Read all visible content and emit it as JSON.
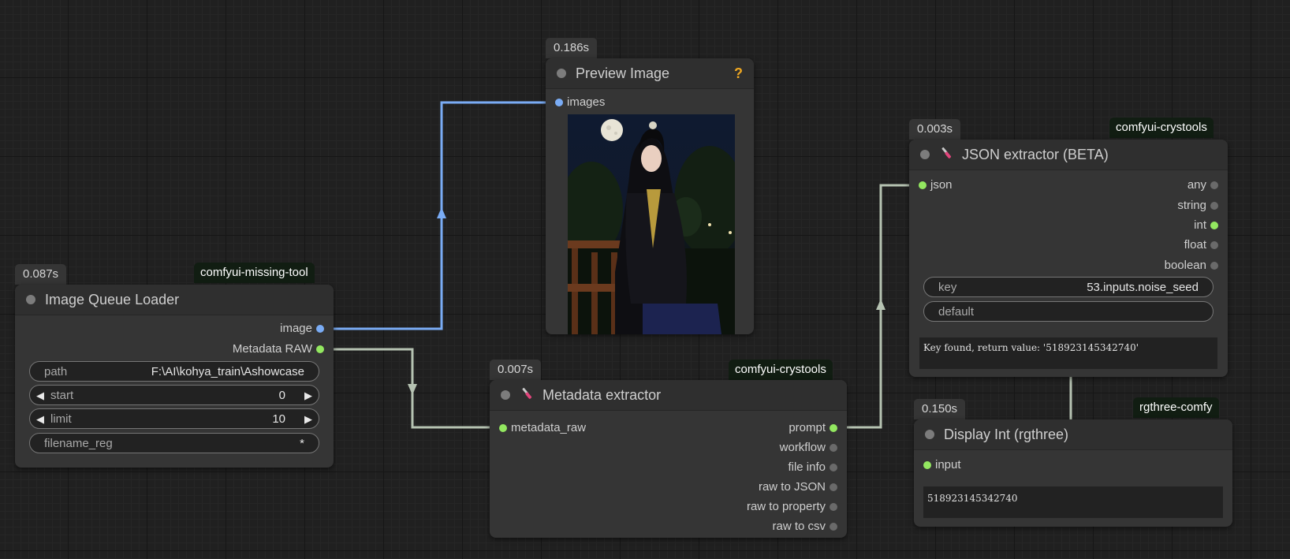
{
  "colors": {
    "canvas": "#202020",
    "node_body": "#353535",
    "image_link": "#7aacf5",
    "string_link": "#b6c3b2",
    "slot_green": "#93e860",
    "slot_blue": "#7aacf5",
    "help_icon": "#f0a821"
  },
  "nodes": {
    "loader": {
      "timing": "0.087s",
      "pack": "comfyui-missing-tool",
      "title": "Image Queue Loader",
      "outputs": [
        "image",
        "Metadata RAW"
      ],
      "widgets": {
        "path": {
          "label": "path",
          "value": "F:\\AI\\kohya_train\\Ashowcase"
        },
        "start": {
          "label": "start",
          "value": "0"
        },
        "limit": {
          "label": "limit",
          "value": "10"
        },
        "filename_reg": {
          "label": "filename_reg",
          "value": "*"
        }
      },
      "icons": {
        "decrement": "arrow-left-icon",
        "increment": "arrow-right-icon"
      }
    },
    "preview": {
      "timing": "0.186s",
      "title": "Preview Image",
      "help": "?",
      "inputs": [
        "images"
      ],
      "image": "preview-image"
    },
    "metadata": {
      "timing": "0.007s",
      "pack": "comfyui-crystools",
      "title": "Metadata extractor",
      "icon": "wrench-icon",
      "inputs": [
        "metadata_raw"
      ],
      "outputs": [
        "prompt",
        "workflow",
        "file info",
        "raw to JSON",
        "raw to property",
        "raw to csv"
      ]
    },
    "json": {
      "timing": "0.003s",
      "pack": "comfyui-crystools",
      "title": "JSON extractor (BETA)",
      "icon": "wrench-icon",
      "inputs": [
        "json"
      ],
      "outputs": [
        "any",
        "string",
        "int",
        "float",
        "boolean"
      ],
      "widgets": {
        "key": {
          "label": "key",
          "value": "53.inputs.noise_seed"
        },
        "default": {
          "label": "default",
          "value": ""
        }
      },
      "result": "Key found, return value: '518923145342740'"
    },
    "display": {
      "timing": "0.150s",
      "pack": "rgthree-comfy",
      "title": "Display Int (rgthree)",
      "inputs": [
        "input"
      ],
      "value": "518923145342740"
    }
  }
}
